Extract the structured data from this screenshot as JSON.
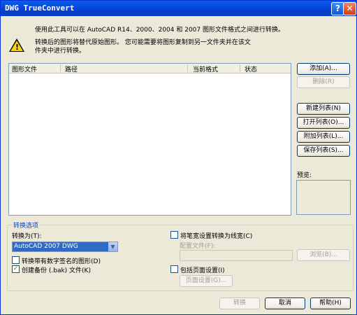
{
  "window": {
    "title": "DWG TrueConvert",
    "help_icon": "?",
    "close_icon": "✕"
  },
  "info": {
    "line1": "使用此工具可以在 AutoCAD R14、2000、2004 和 2007 图形文件格式之间进行转换。",
    "warn_line1": "转换后的图形将替代原始图形。 您可能需要将图形复制到另一文件夹并在该文",
    "warn_line2": "件夹中进行转换。"
  },
  "file_list": {
    "columns": [
      "图形文件",
      "路径",
      "当前格式",
      "状态"
    ],
    "rows": []
  },
  "buttons": {
    "add": "添加(A)...",
    "remove": "删除(R)",
    "new_list": "新建列表(N)",
    "open_list": "打开列表(O)...",
    "append_list": "附加列表(L)...",
    "save_list": "保存列表(S)...",
    "convert": "转换",
    "cancel": "取消",
    "help": "帮助(H)",
    "browse": "浏览(B)...",
    "page_setup": "页面设置(G)..."
  },
  "preview_label": "预览:",
  "options": {
    "group_label": "转换选项",
    "convert_to_label": "转换为(T):",
    "convert_to_value": "AutoCAD 2007 DWG",
    "digital_sig": {
      "label": "转换带有数字签名的图形(D)",
      "checked": false
    },
    "backup": {
      "label": "创建备份 (.bak) 文件(K)",
      "checked": true
    },
    "pen_width": {
      "label": "将笔宽设置转换为线宽(C)",
      "checked": false
    },
    "config_file_label": "配置文件(F):",
    "config_file_value": "",
    "page_setup": {
      "label": "包括页面设置(I)",
      "checked": false
    }
  }
}
